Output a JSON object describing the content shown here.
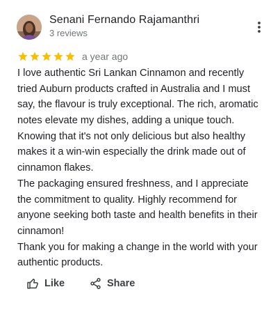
{
  "review": {
    "reviewer_name": "Senani Fernando Rajamanthri",
    "reviewer_meta": "3 reviews",
    "rating": 5,
    "rating_max": 5,
    "date": "a year ago",
    "body_lines": [
      "I love authentic Sri Lankan Cinnamon and recently",
      "tried Auburn products crafted in Australia and I must",
      "say, the flavour is truly exceptional. The rich, aromatic",
      "notes elevate my dishes, adding a unique touch.",
      "Knowing that it's not only delicious but also healthy",
      "makes it a win-win especially the drink made out of",
      "cinnamon flakes.",
      "The packaging ensured freshness, and I appreciate",
      "the commitment to quality. Highly recommend for",
      "anyone seeking both taste and health benefits in their",
      "cinnamon!",
      "Thank you for making a change in the world with your",
      "authentic products."
    ]
  },
  "actions": {
    "like_label": "Like",
    "share_label": "Share"
  },
  "icons": {
    "more": "more-vertical-icon",
    "star": "star-icon",
    "like": "thumbs-up-icon",
    "share": "share-icon"
  },
  "colors": {
    "star": "#fbbc04",
    "text": "#202124",
    "secondary_text": "#70757a",
    "action_text": "#3c4043"
  }
}
